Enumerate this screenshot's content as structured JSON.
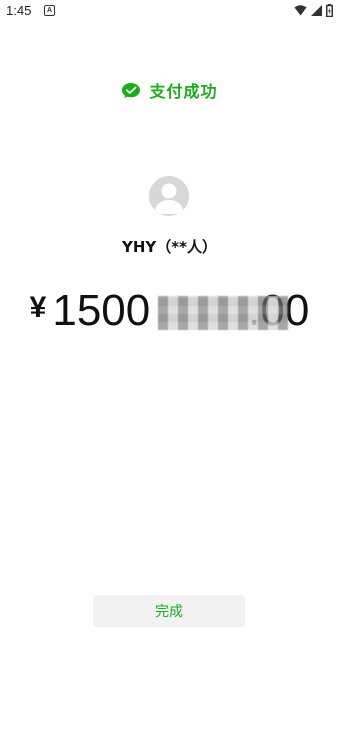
{
  "status_bar": {
    "time": "1:45",
    "notification_icon": "A"
  },
  "payment": {
    "success_text": "支付成功",
    "payee": "YHY（**人）",
    "currency_symbol": "¥",
    "amount_visible_prefix": "1500",
    "amount_visible_suffix": ".00",
    "amount_masked": true
  },
  "actions": {
    "done_label": "完成"
  },
  "colors": {
    "brand_green": "#1aad19",
    "background": "#ffffff",
    "button_bg": "#f2f2f2",
    "avatar_bg": "#d7d7d7"
  }
}
